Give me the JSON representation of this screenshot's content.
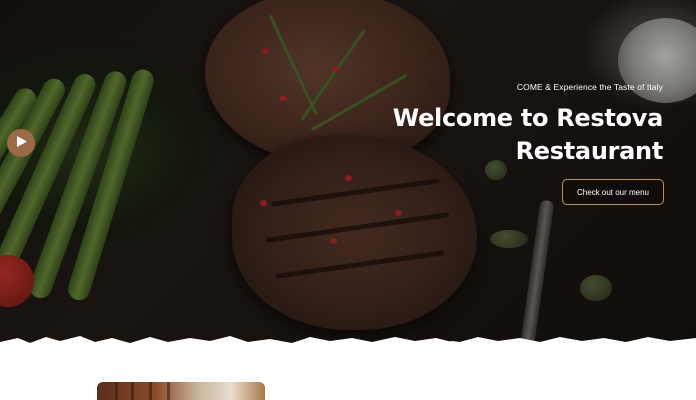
{
  "hero": {
    "tagline": "COME & Experience the Taste of Italy",
    "headline_line1": "Welcome to Restova",
    "headline_line2": "Restaurant",
    "cta_label": "Check out our menu",
    "play_icon": "play-icon"
  },
  "colors": {
    "accent": "#9a6b48",
    "button_border": "#b9915f",
    "text": "#ffffff"
  }
}
